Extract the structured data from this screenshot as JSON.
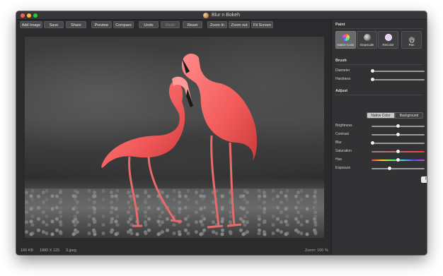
{
  "window": {
    "title": "Blur n Bokeh"
  },
  "toolbar": {
    "add_image": "Add Image",
    "save": "Save",
    "share": "Share",
    "preview": "Preview",
    "compare": "Compare",
    "undo": "Undo",
    "redo": "Redo",
    "reset": "Reset",
    "zoom_in": "Zoom In",
    "zoom_out": "Zoom out",
    "fit_screen": "Fit Screen"
  },
  "status": {
    "file_size": "166 KB",
    "dimensions": "1880 X 125",
    "filename": "3.jpeg",
    "zoom": "Zoom: 100 %"
  },
  "panel": {
    "paint_title": "Paint",
    "tools": [
      {
        "label": "Native Color",
        "icon": "color-wheel-icon",
        "active": true
      },
      {
        "label": "Grayscale",
        "icon": "grayscale-icon",
        "active": false
      },
      {
        "label": "ReColor",
        "icon": "recolor-icon",
        "active": false
      },
      {
        "label": "Pan",
        "icon": "hand-icon",
        "active": false
      }
    ],
    "brush_title": "Brush",
    "brush": [
      {
        "label": "Diameter",
        "value": "0",
        "level": 0.0
      },
      {
        "label": "Hardness",
        "value": "0",
        "level": 0.0
      }
    ],
    "adjust_title": "Adjust",
    "segments": {
      "native": "Native Color",
      "background": "Background"
    },
    "adjust": [
      {
        "label": "Brightness",
        "value": "0",
        "level": 0.5
      },
      {
        "label": "Contrast",
        "value": "0",
        "level": 0.5
      },
      {
        "label": "Blur",
        "value": "0",
        "level": 0.0
      },
      {
        "label": "Saturation",
        "value": "50",
        "level": 0.5
      },
      {
        "label": "Hue",
        "value": "0",
        "level": 0.5
      },
      {
        "label": "Exposure",
        "value": "34",
        "level": 0.34
      }
    ],
    "reset_label": "Reset"
  },
  "colors": {
    "accent_flamingo": "#f56a6a",
    "background_dark": "#2b2b2d"
  }
}
